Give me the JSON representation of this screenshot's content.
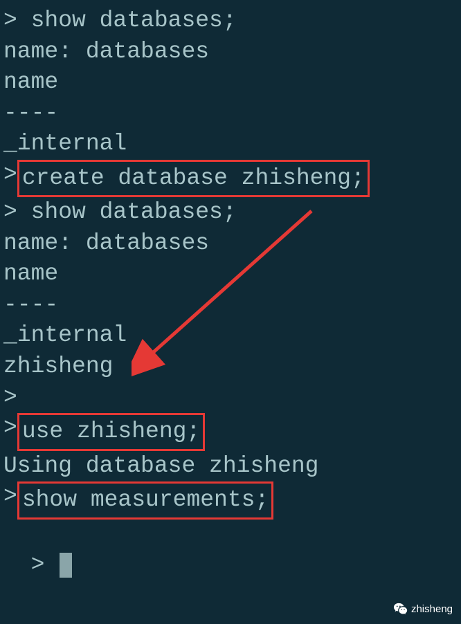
{
  "terminal": {
    "prompt": ">",
    "lines": {
      "cmd1": "> show databases;",
      "out1_header": "name: databases",
      "out1_col": "name",
      "dash": "----",
      "internal": "_internal",
      "prompt_pre_box1": "> ",
      "cmd_create": "create database zhisheng;",
      "cmd2": "> show databases;",
      "out2_header": "name: databases",
      "out2_col": "name",
      "dash2": "----",
      "internal2": "_internal",
      "zhisheng": "zhisheng",
      "empty_prompt": ">",
      "prompt_pre_box2": "> ",
      "cmd_use": "use zhisheng;",
      "using_msg": "Using database zhisheng",
      "prompt_pre_box3": "> ",
      "cmd_show_meas": "show measurements;",
      "final_prompt": "> "
    }
  },
  "watermark": {
    "text": "zhisheng"
  },
  "annotation": {
    "color": "#e53935"
  }
}
